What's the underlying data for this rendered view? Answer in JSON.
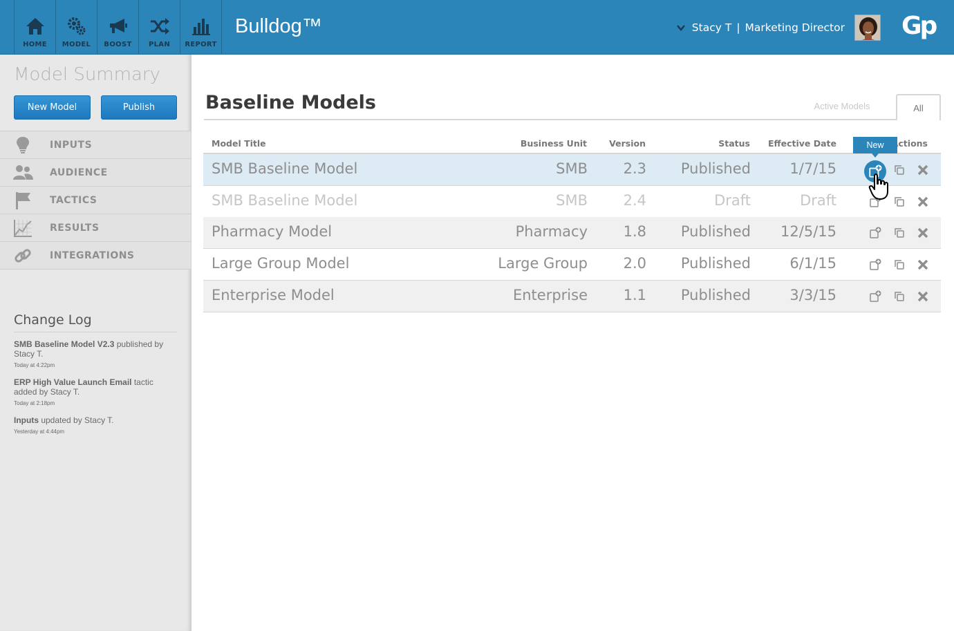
{
  "nav": {
    "items": [
      {
        "label": "HOME",
        "icon": "home-icon"
      },
      {
        "label": "MODEL",
        "icon": "gears-icon"
      },
      {
        "label": "BOOST",
        "icon": "megaphone-icon"
      },
      {
        "label": "PLAN",
        "icon": "shuffle-icon"
      },
      {
        "label": "REPORT",
        "icon": "bar-chart-icon"
      }
    ]
  },
  "header": {
    "brand": "Bulldog™",
    "user_name": "Stacy T",
    "separator": "|",
    "user_role": "Marketing Director",
    "logo": "Gp"
  },
  "sidebar": {
    "title": "Model Summary",
    "new_model_label": "New Model",
    "publish_label": "Publish",
    "menu": [
      {
        "label": "INPUTS",
        "icon": "lightbulb-icon"
      },
      {
        "label": "AUDIENCE",
        "icon": "users-icon"
      },
      {
        "label": "TACTICS",
        "icon": "flag-icon"
      },
      {
        "label": "RESULTS",
        "icon": "line-chart-icon"
      },
      {
        "label": "INTEGRATIONS",
        "icon": "link-icon"
      }
    ],
    "changelog": {
      "title": "Change Log",
      "entries": [
        {
          "bold": "SMB Baseline Model V2.3",
          "text": " published by Stacy T.",
          "time": "Today at 4:22pm"
        },
        {
          "bold": "ERP High Value Launch Email",
          "text": " tactic added by Stacy T.",
          "time": "Today at 2:18pm"
        },
        {
          "bold": "Inputs",
          "text": " updated by Stacy T.",
          "time": "Yesterday at 4:44pm"
        }
      ]
    }
  },
  "main": {
    "title": "Baseline Models",
    "tabs": {
      "active_models": "Active Models",
      "all": "All"
    },
    "columns": {
      "title": "Model Title",
      "unit": "Business Unit",
      "version": "Version",
      "status": "Status",
      "date": "Effective Date",
      "actions": "Actions"
    },
    "rows": [
      {
        "title": "SMB Baseline Model",
        "unit": "SMB",
        "version": "2.3",
        "status": "Published",
        "date": "1/7/15"
      },
      {
        "title": "SMB Baseline Model",
        "unit": "SMB",
        "version": "2.4",
        "status": "Draft",
        "date": "Draft"
      },
      {
        "title": "Pharmacy Model",
        "unit": "Pharmacy",
        "version": "1.8",
        "status": "Published",
        "date": "12/5/15"
      },
      {
        "title": "Large Group Model",
        "unit": "Large Group",
        "version": "2.0",
        "status": "Published",
        "date": "6/1/15"
      },
      {
        "title": "Enterprise Model",
        "unit": "Enterprise",
        "version": "1.1",
        "status": "Published",
        "date": "3/3/15"
      }
    ],
    "tooltip": "New"
  },
  "colors": {
    "topbar": "#2b85b9",
    "nav_label": "#1a3a52",
    "highlight_row": "#dcebf4",
    "button": "#1e78bd"
  }
}
